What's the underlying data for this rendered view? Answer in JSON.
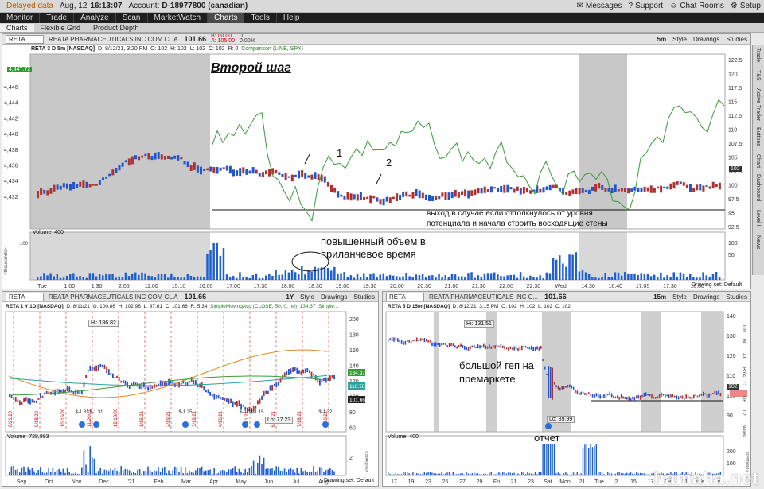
{
  "topbar": {
    "delayed": "Delayed data",
    "date": "Aug, 12",
    "time": "16:13:07",
    "account_label": "Account:",
    "account": "D-18977800 (canadian)",
    "messages": "Messages",
    "support": "Support",
    "chat_rooms": "Chat Rooms",
    "setup": "Setup"
  },
  "menu": [
    "Monitor",
    "Trade",
    "Analyze",
    "Scan",
    "MarketWatch",
    "Charts",
    "Tools",
    "Help"
  ],
  "menu_active": "Charts",
  "subtabs": [
    "Charts",
    "Flexible Grid",
    "Product Depth"
  ],
  "top_panel": {
    "symbol": "RETA",
    "name": "REATA PHARMACEUTICALS INC COM CL A",
    "price": "101.66",
    "bid": "B: 00.00",
    "ask": "A: 105.00",
    "change": "0",
    "change_pct": "0.00%",
    "timeframe": "5m",
    "style": "Style",
    "drawings": "Drawings",
    "studies": "Studies",
    "study_line": "RETA 3 D 5m [NASDAQ]",
    "study_d": "D: 8/12/21, 3:20 PM",
    "study_o": "O: 102",
    "study_h": "H: 102",
    "study_l": "L: 102",
    "study_c": "C: 102",
    "study_r": "R: 0",
    "comparison": "Comparison (LINE, SPX)",
    "spx_label": "4,447.72",
    "volume_label": "Volume",
    "volume_value": "400",
    "annotation_title": "Второй шаг",
    "annotation_1": "1",
    "annotation_2": "2",
    "annotation_exit": "выход в случае если оттолкнулось от уровня потенциала и начала строить восходящие стены",
    "annotation_volume": "повышенный объем в приланчевое время",
    "drawing_set": "Drawing set: Default",
    "price_badge": "102",
    "left_axis": [
      "4,446",
      "4,444",
      "4,442",
      "4,440",
      "4,438",
      "4,436",
      "4,434",
      "4,432"
    ],
    "right_axis": [
      "122.5",
      "120",
      "117.5",
      "115",
      "112.5",
      "110",
      "107.5",
      "105",
      "102.5",
      "100",
      "97.5",
      "95",
      "92.5"
    ],
    "volume_axis": [
      "100",
      "50"
    ],
    "thousands": "<thousands>",
    "time_axis": [
      "Tue",
      "1:00",
      "1:30",
      "2:05",
      "11:00",
      "15:10",
      "16:05",
      "17:00",
      "17:30",
      "18:00",
      "18:30",
      "19:00",
      "19:30",
      "20:00",
      "20:30",
      "21:00",
      "21:30",
      "22:00",
      "22:30",
      "Wed",
      "14:30",
      "16:40",
      "17:05",
      "17:30",
      "18:00"
    ]
  },
  "sidebar": [
    "Trade",
    "T&S",
    "Active Trader",
    "Buttons",
    "Chart",
    "Dashboard",
    "Level II",
    "News"
  ],
  "bottom_left": {
    "symbol": "RETA",
    "name": "REATA PHARMACEUTICALS INC COM CL A",
    "price": "101.66",
    "timeframe": "1Y",
    "style": "Style",
    "drawings": "Drawings",
    "studies": "Studies",
    "study_line": "RETA 1 Y 1D [NASDAQ]",
    "study_d": "D: 8/11/21",
    "study_o": "O: 100.86",
    "study_h": "H: 102.96",
    "study_l": "L: 97.61",
    "study_c": "C: 101.66",
    "study_r": "R: 5.34",
    "sma": "SimpleMovingAvg (CLOSE, 50, 0, no)",
    "sma_value": "134.37",
    "sma_more": "Simple...",
    "hi": "Hi: 186.82",
    "lo": "Lo: 77.23",
    "right_axis": [
      "200",
      "180",
      "160",
      "140",
      "120",
      "100",
      "80",
      "60"
    ],
    "badges": [
      "134.37",
      "116.78",
      "101.66"
    ],
    "volume_label": "Volume",
    "volume_value": "728,893",
    "millions": "<millions>",
    "vol_axis": [
      "2"
    ],
    "time_axis": [
      "Sep",
      "Oct",
      "Nov",
      "Dec",
      "'21",
      "Feb",
      "Mar",
      "Apr",
      "May",
      "Jun",
      "Jul",
      "Aug"
    ],
    "dates": [
      "8/21/20",
      "9/18/20",
      "10/16/20",
      "11/20/20",
      "12/18/20",
      "1/15/21",
      "2/19/21",
      "3/19/21",
      "4/16/21",
      "5/21/21",
      "6/18/21",
      "7/16/21",
      "8/20/21"
    ],
    "events": [
      "$-1.31",
      "$-1.31",
      "$-1.25",
      "$-1.3",
      "$-1.15",
      "$-1.32"
    ],
    "drawing_set": "Drawing set: Default"
  },
  "bottom_right": {
    "symbol": "RETA",
    "name": "REATA PHARMACEUTICALS INC C...",
    "price": "101.66",
    "timeframe": "15m",
    "style": "Style",
    "drawings": "Drawings",
    "studies": "Studies",
    "study_line": "RETA 5 D 15m [NASDAQ]",
    "study_d": "D: 8/12/21, 3:15 PM",
    "study_o": "O: 102",
    "study_h": "H: 102",
    "study_l": "L: 102",
    "study_c": "C: 102",
    "hi": "Hi: 131.51",
    "lo": "Lo: 89.99",
    "event": "$-1",
    "annotation_gap": "большой геп на премаркете",
    "annotation_report": "отчет",
    "right_axis": [
      "140",
      "130",
      "120",
      "110",
      "100",
      "90"
    ],
    "price_badge": "102",
    "volume_label": "Volume",
    "volume_value": "400",
    "vol_axis": [
      "200",
      "100"
    ],
    "thousands": "<thousan",
    "time_axis": [
      "17",
      "19",
      "23",
      "25",
      "27",
      "29",
      "Fri",
      "21",
      "23",
      "Sat",
      "Mon",
      "21",
      "Tue",
      "2",
      "15",
      "17",
      "19",
      "21",
      "Wed",
      "Thu"
    ],
    "left_tabs": [
      "Trd",
      "Bl",
      "AT",
      "Btns",
      "C",
      "DB",
      "L2",
      "News"
    ]
  },
  "watermark": "hamaha.net"
}
